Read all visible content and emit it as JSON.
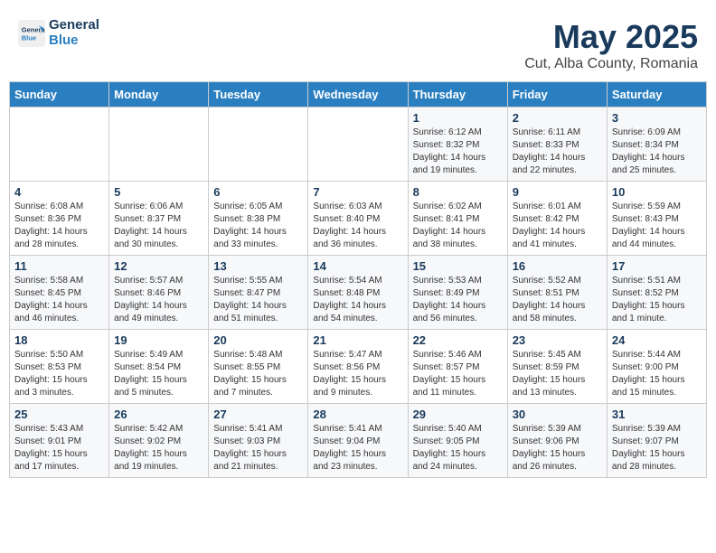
{
  "logo": {
    "line1": "General",
    "line2": "Blue"
  },
  "title": "May 2025",
  "subtitle": "Cut, Alba County, Romania",
  "weekdays": [
    "Sunday",
    "Monday",
    "Tuesday",
    "Wednesday",
    "Thursday",
    "Friday",
    "Saturday"
  ],
  "weeks": [
    [
      {
        "day": "",
        "info": ""
      },
      {
        "day": "",
        "info": ""
      },
      {
        "day": "",
        "info": ""
      },
      {
        "day": "",
        "info": ""
      },
      {
        "day": "1",
        "info": "Sunrise: 6:12 AM\nSunset: 8:32 PM\nDaylight: 14 hours\nand 19 minutes."
      },
      {
        "day": "2",
        "info": "Sunrise: 6:11 AM\nSunset: 8:33 PM\nDaylight: 14 hours\nand 22 minutes."
      },
      {
        "day": "3",
        "info": "Sunrise: 6:09 AM\nSunset: 8:34 PM\nDaylight: 14 hours\nand 25 minutes."
      }
    ],
    [
      {
        "day": "4",
        "info": "Sunrise: 6:08 AM\nSunset: 8:36 PM\nDaylight: 14 hours\nand 28 minutes."
      },
      {
        "day": "5",
        "info": "Sunrise: 6:06 AM\nSunset: 8:37 PM\nDaylight: 14 hours\nand 30 minutes."
      },
      {
        "day": "6",
        "info": "Sunrise: 6:05 AM\nSunset: 8:38 PM\nDaylight: 14 hours\nand 33 minutes."
      },
      {
        "day": "7",
        "info": "Sunrise: 6:03 AM\nSunset: 8:40 PM\nDaylight: 14 hours\nand 36 minutes."
      },
      {
        "day": "8",
        "info": "Sunrise: 6:02 AM\nSunset: 8:41 PM\nDaylight: 14 hours\nand 38 minutes."
      },
      {
        "day": "9",
        "info": "Sunrise: 6:01 AM\nSunset: 8:42 PM\nDaylight: 14 hours\nand 41 minutes."
      },
      {
        "day": "10",
        "info": "Sunrise: 5:59 AM\nSunset: 8:43 PM\nDaylight: 14 hours\nand 44 minutes."
      }
    ],
    [
      {
        "day": "11",
        "info": "Sunrise: 5:58 AM\nSunset: 8:45 PM\nDaylight: 14 hours\nand 46 minutes."
      },
      {
        "day": "12",
        "info": "Sunrise: 5:57 AM\nSunset: 8:46 PM\nDaylight: 14 hours\nand 49 minutes."
      },
      {
        "day": "13",
        "info": "Sunrise: 5:55 AM\nSunset: 8:47 PM\nDaylight: 14 hours\nand 51 minutes."
      },
      {
        "day": "14",
        "info": "Sunrise: 5:54 AM\nSunset: 8:48 PM\nDaylight: 14 hours\nand 54 minutes."
      },
      {
        "day": "15",
        "info": "Sunrise: 5:53 AM\nSunset: 8:49 PM\nDaylight: 14 hours\nand 56 minutes."
      },
      {
        "day": "16",
        "info": "Sunrise: 5:52 AM\nSunset: 8:51 PM\nDaylight: 14 hours\nand 58 minutes."
      },
      {
        "day": "17",
        "info": "Sunrise: 5:51 AM\nSunset: 8:52 PM\nDaylight: 15 hours\nand 1 minute."
      }
    ],
    [
      {
        "day": "18",
        "info": "Sunrise: 5:50 AM\nSunset: 8:53 PM\nDaylight: 15 hours\nand 3 minutes."
      },
      {
        "day": "19",
        "info": "Sunrise: 5:49 AM\nSunset: 8:54 PM\nDaylight: 15 hours\nand 5 minutes."
      },
      {
        "day": "20",
        "info": "Sunrise: 5:48 AM\nSunset: 8:55 PM\nDaylight: 15 hours\nand 7 minutes."
      },
      {
        "day": "21",
        "info": "Sunrise: 5:47 AM\nSunset: 8:56 PM\nDaylight: 15 hours\nand 9 minutes."
      },
      {
        "day": "22",
        "info": "Sunrise: 5:46 AM\nSunset: 8:57 PM\nDaylight: 15 hours\nand 11 minutes."
      },
      {
        "day": "23",
        "info": "Sunrise: 5:45 AM\nSunset: 8:59 PM\nDaylight: 15 hours\nand 13 minutes."
      },
      {
        "day": "24",
        "info": "Sunrise: 5:44 AM\nSunset: 9:00 PM\nDaylight: 15 hours\nand 15 minutes."
      }
    ],
    [
      {
        "day": "25",
        "info": "Sunrise: 5:43 AM\nSunset: 9:01 PM\nDaylight: 15 hours\nand 17 minutes."
      },
      {
        "day": "26",
        "info": "Sunrise: 5:42 AM\nSunset: 9:02 PM\nDaylight: 15 hours\nand 19 minutes."
      },
      {
        "day": "27",
        "info": "Sunrise: 5:41 AM\nSunset: 9:03 PM\nDaylight: 15 hours\nand 21 minutes."
      },
      {
        "day": "28",
        "info": "Sunrise: 5:41 AM\nSunset: 9:04 PM\nDaylight: 15 hours\nand 23 minutes."
      },
      {
        "day": "29",
        "info": "Sunrise: 5:40 AM\nSunset: 9:05 PM\nDaylight: 15 hours\nand 24 minutes."
      },
      {
        "day": "30",
        "info": "Sunrise: 5:39 AM\nSunset: 9:06 PM\nDaylight: 15 hours\nand 26 minutes."
      },
      {
        "day": "31",
        "info": "Sunrise: 5:39 AM\nSunset: 9:07 PM\nDaylight: 15 hours\nand 28 minutes."
      }
    ]
  ]
}
